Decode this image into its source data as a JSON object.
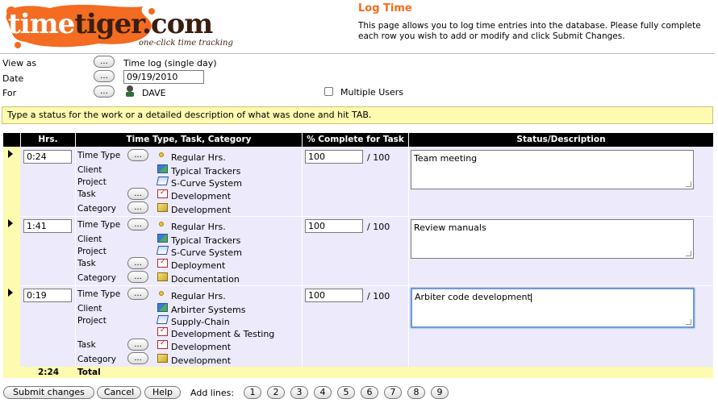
{
  "logo": {
    "word_time": "time",
    "word_tiger": "tiger.com",
    "tagline": "one-click time tracking"
  },
  "page": {
    "title": "Log Time",
    "intro": "This page allows you to log time entries into the database. Please fully complete each row you wish to add or modify and click Submit Changes."
  },
  "filters": {
    "view_as_label": "View as",
    "view_as_value": "Time log (single day)",
    "date_label": "Date",
    "date_value": "09/19/2010",
    "for_label": "For",
    "for_value": "DAVE",
    "multiple_users_label": "Multiple Users",
    "ellipsis": "..."
  },
  "status_message": "Type a status for the work or a detailed description of what was done and hit TAB.",
  "table": {
    "headers": [
      "Hrs.",
      "Time Type, Task, Category",
      "% Complete for Task",
      "Status/Description"
    ],
    "field_labels": {
      "time_type": "Time Type",
      "client": "Client",
      "project": "Project",
      "task": "Task",
      "category": "Category"
    },
    "rows": [
      {
        "hrs": "0:24",
        "time_type": "Regular Hrs.",
        "client": "Typical Trackers",
        "project": "S-Curve System",
        "task": "Development",
        "category": "Development",
        "pct": "100",
        "of": "/ 100",
        "status": "Team meeting"
      },
      {
        "hrs": "1:41",
        "time_type": "Regular Hrs.",
        "client": "Typical Trackers",
        "project": "S-Curve System",
        "task": "Deployment",
        "category": "Documentation",
        "pct": "100",
        "of": "/ 100",
        "status": "Review manuals"
      },
      {
        "hrs": "0:19",
        "time_type": "Regular Hrs.",
        "client": "Arbirter Systems",
        "project": "Supply-Chain",
        "task_group": "Development & Testing",
        "task": "Development",
        "category": "Development",
        "pct": "100",
        "of": "/ 100",
        "status": "Arbiter code development"
      }
    ],
    "total_hrs": "2:24",
    "total_label": "Total"
  },
  "footer": {
    "submit": "Submit changes",
    "cancel": "Cancel",
    "help": "Help",
    "add_lines_label": "Add lines:",
    "add_lines": [
      "1",
      "2",
      "3",
      "4",
      "5",
      "6",
      "7",
      "8",
      "9"
    ]
  },
  "colors": {
    "accent": "#f26b1d",
    "row_bg": "#eceafb",
    "highlight": "#fdfbb0",
    "header_bg": "#000000"
  }
}
